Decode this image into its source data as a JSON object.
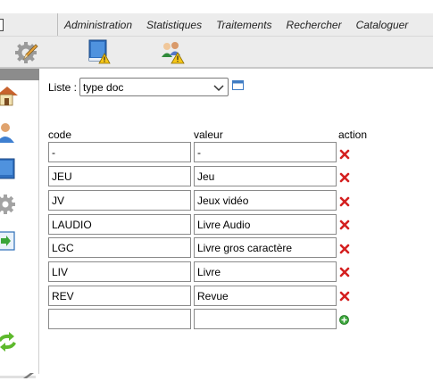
{
  "menu": {
    "items": [
      "Administration",
      "Statistiques",
      "Traitements",
      "Rechercher",
      "Cataloguer"
    ]
  },
  "toolbar": {
    "icons": [
      "settings-pencil-icon",
      "book-warning-icon",
      "users-warning-icon"
    ]
  },
  "sidebar": {
    "icons": [
      "home-icon",
      "user-icon",
      "book-icon",
      "gear-icon",
      "import-icon",
      "refresh-icon"
    ]
  },
  "list": {
    "label": "Liste :",
    "selected": "type doc"
  },
  "table": {
    "headers": {
      "code": "code",
      "value": "valeur",
      "action": "action"
    },
    "rows": [
      {
        "code": "-",
        "value": "-"
      },
      {
        "code": "JEU",
        "value": "Jeu"
      },
      {
        "code": "JV",
        "value": "Jeux vidéo"
      },
      {
        "code": "LAUDIO",
        "value": "Livre Audio"
      },
      {
        "code": "LGC",
        "value": "Livre gros caractère"
      },
      {
        "code": "LIV",
        "value": "Livre"
      },
      {
        "code": "REV",
        "value": "Revue"
      }
    ],
    "new_row": {
      "code": "",
      "value": ""
    }
  },
  "colors": {
    "delete": "#d42020",
    "add": "#3aa53a",
    "bar_bg": "#ececec",
    "sidebar_head": "#8c8c8c"
  }
}
